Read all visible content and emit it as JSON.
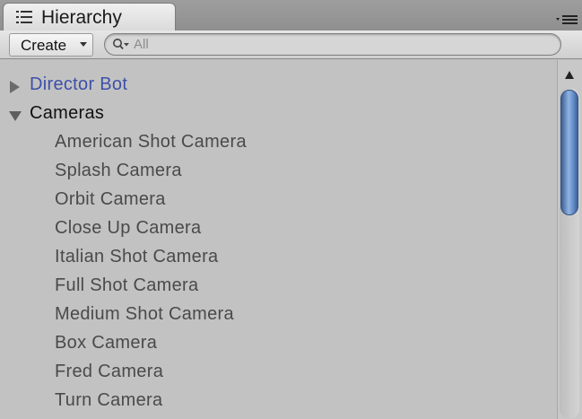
{
  "window": {
    "tab_title": "Hierarchy",
    "tab_icon": "list-icon",
    "menu_icon": "panel-menu-icon"
  },
  "toolbar": {
    "create_label": "Create",
    "search": {
      "value": "",
      "placeholder": "All",
      "icon": "search-icon"
    }
  },
  "colors": {
    "background": "#c2c2c2",
    "link_blue": "#3c50a8",
    "child_text": "#4a4a4a",
    "root_text": "#111111",
    "scroll_thumb": "#6a93cc"
  },
  "tree": {
    "items": [
      {
        "label": "Director Bot",
        "level": 0,
        "expandable": true,
        "expanded": false,
        "style": "prefab"
      },
      {
        "label": "Cameras",
        "level": 0,
        "expandable": true,
        "expanded": true,
        "style": "normal"
      },
      {
        "label": "American Shot Camera",
        "level": 1
      },
      {
        "label": "Splash Camera",
        "level": 1
      },
      {
        "label": "Orbit Camera",
        "level": 1
      },
      {
        "label": "Close Up Camera",
        "level": 1
      },
      {
        "label": "Italian Shot Camera",
        "level": 1
      },
      {
        "label": "Full Shot Camera",
        "level": 1
      },
      {
        "label": "Medium Shot Camera",
        "level": 1
      },
      {
        "label": "Box Camera",
        "level": 1
      },
      {
        "label": "Fred Camera",
        "level": 1
      },
      {
        "label": "Turn Camera",
        "level": 1
      }
    ]
  },
  "scrollbar": {
    "up_icon": "scroll-up-arrow-icon"
  }
}
